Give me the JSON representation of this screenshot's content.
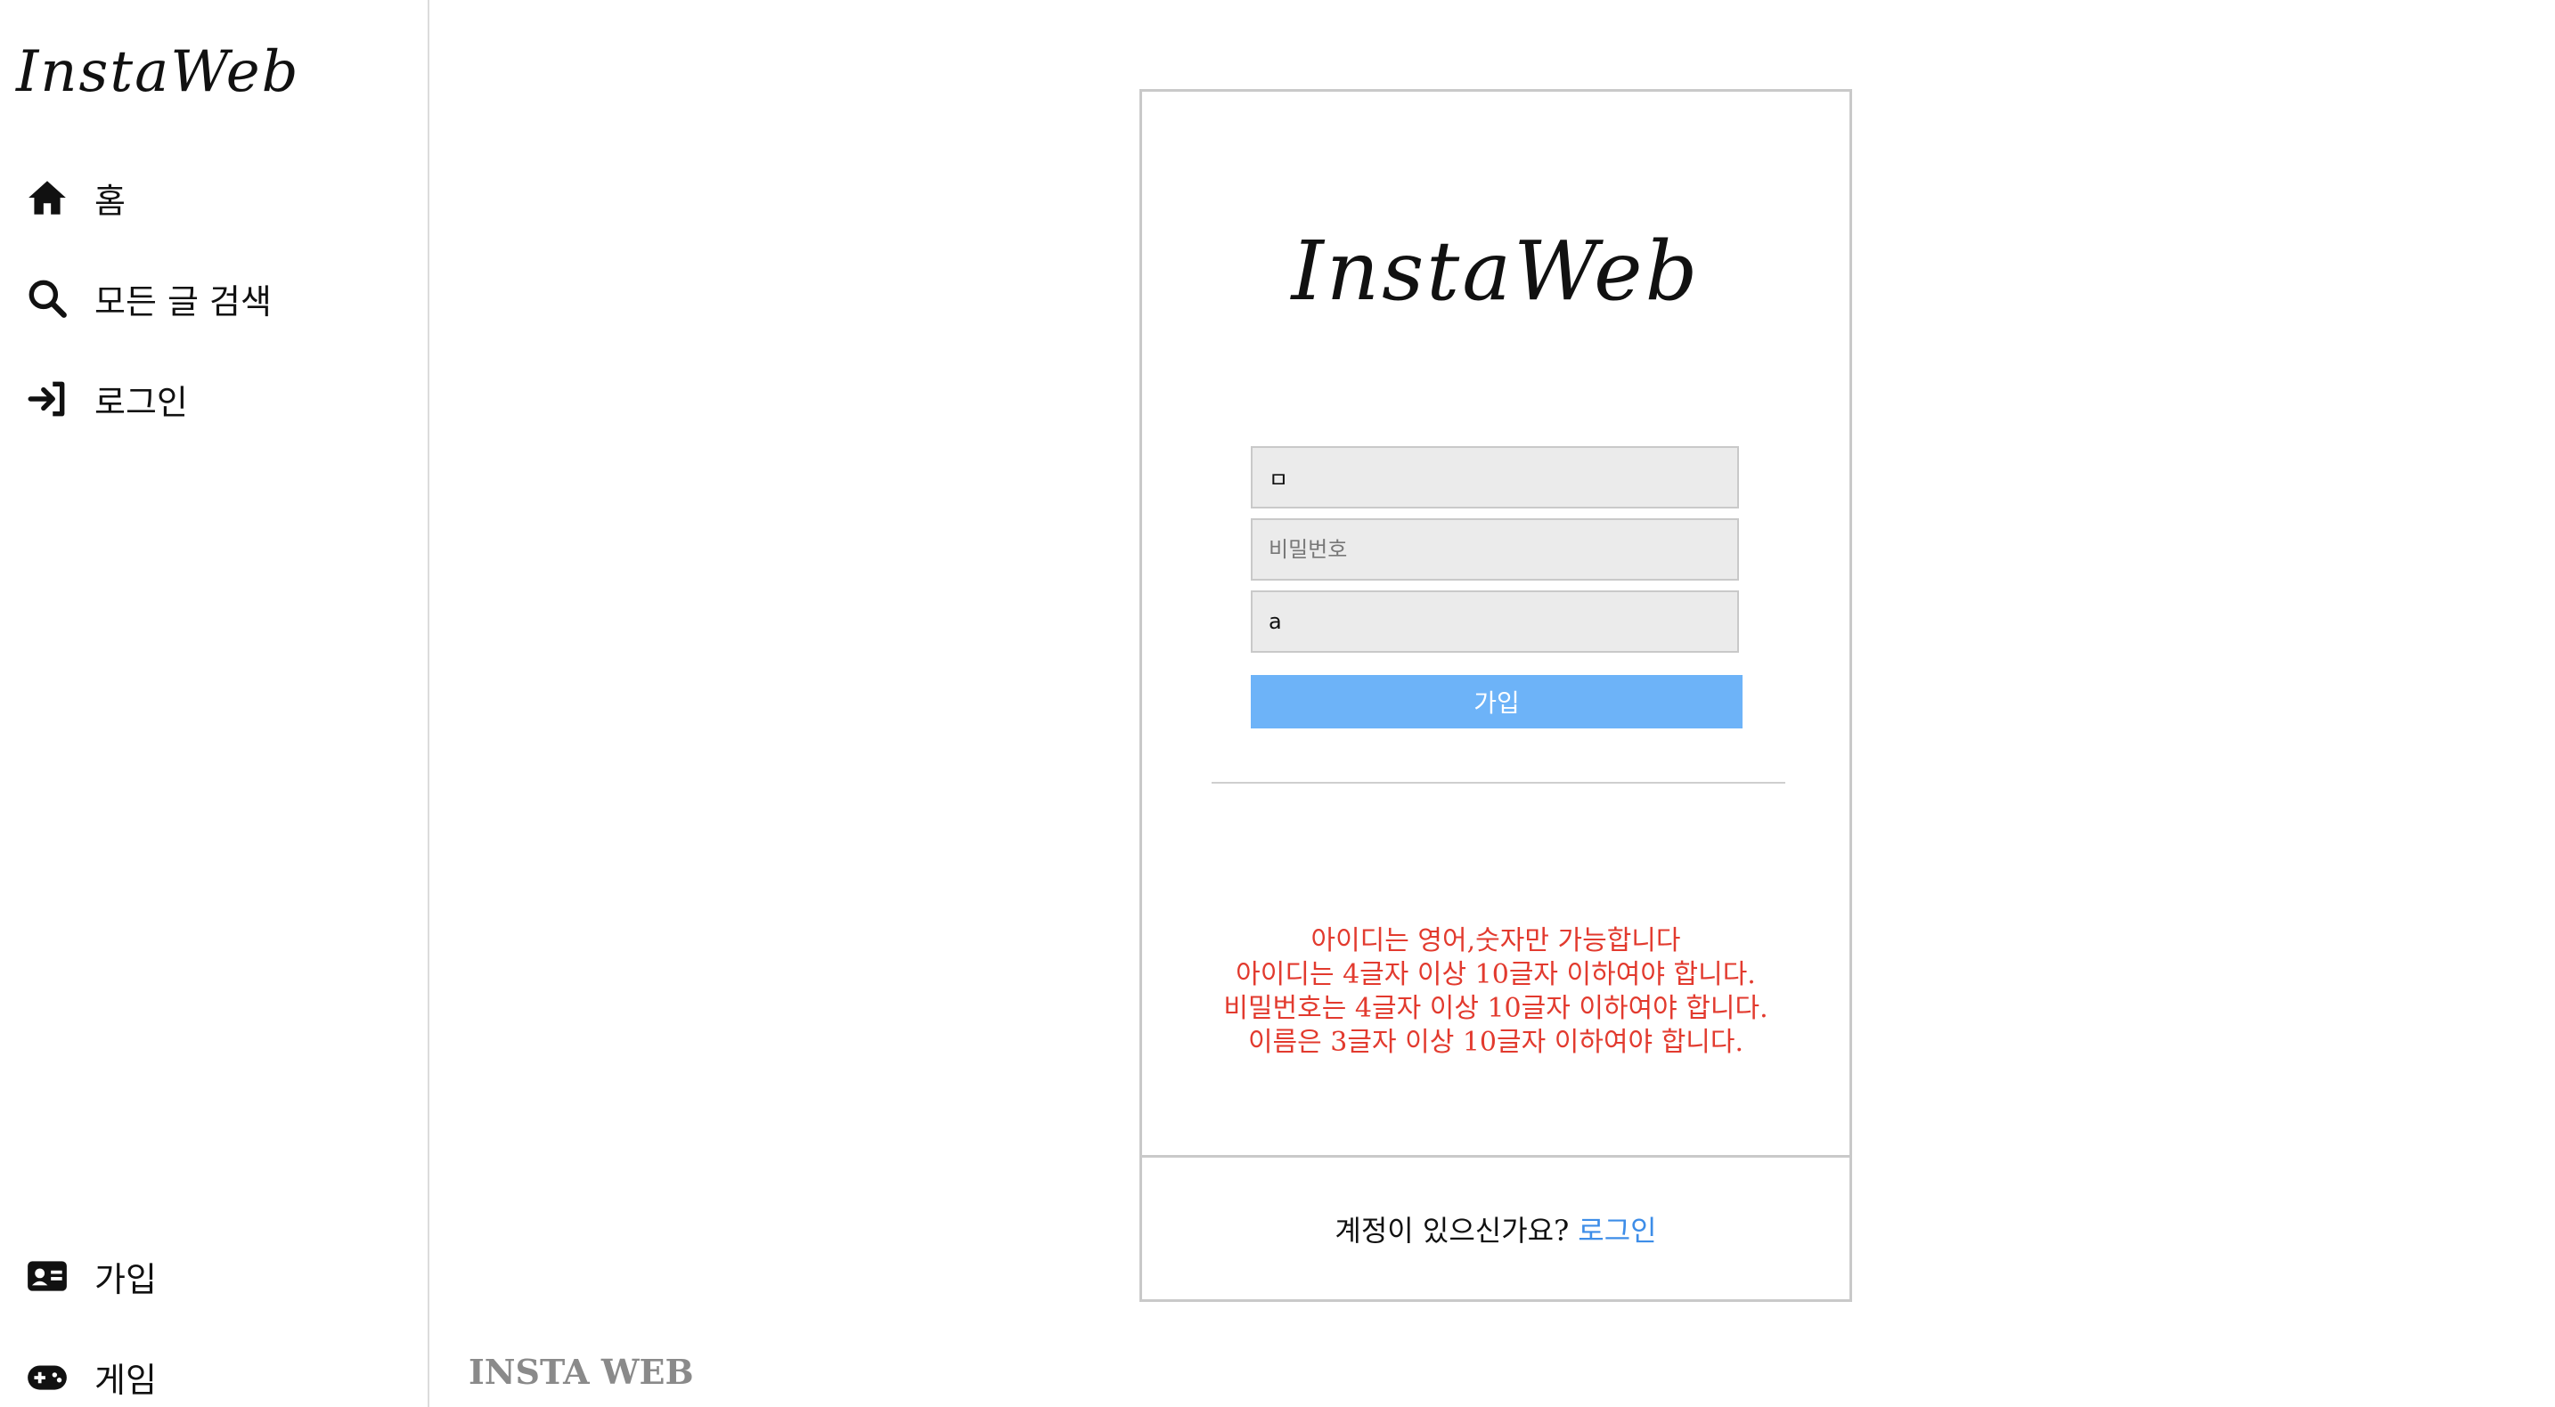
{
  "sidebar": {
    "logo": "InstaWeb",
    "top_items": [
      {
        "label": "홈",
        "icon": "home-icon"
      },
      {
        "label": "모든 글 검색",
        "icon": "search-icon"
      },
      {
        "label": "로그인",
        "icon": "login-icon"
      }
    ],
    "bottom_items": [
      {
        "label": "가입",
        "icon": "id-card-icon"
      },
      {
        "label": "게임",
        "icon": "gamepad-icon"
      }
    ]
  },
  "signup_card": {
    "logo": "InstaWeb",
    "fields": {
      "username_value": "ㅁ",
      "password_placeholder": "비밀번호",
      "name_value": "a"
    },
    "submit_label": "가입",
    "errors": [
      "아이디는 영어,숫자만 가능합니다",
      "아이디는 4글자 이상 10글자 이하여야 합니다.",
      "비밀번호는 4글자 이상 10글자 이하여야 합니다.",
      "이름은 3글자 이상 10글자 이하여야 합니다."
    ],
    "error_color": "#e23a2e",
    "accent_color": "#6db3f8"
  },
  "login_prompt": {
    "text": "계정이 있으신가요?",
    "link": "로그인"
  },
  "footer": {
    "brand": "INSTA WEB"
  }
}
